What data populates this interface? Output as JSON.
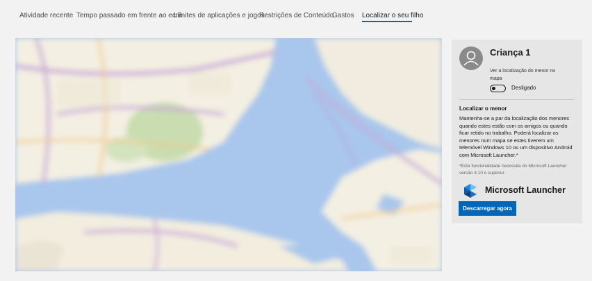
{
  "tabs": [
    {
      "label": "Atividade recente"
    },
    {
      "label": "Tempo passado em frente ao ecrã"
    },
    {
      "label": "Limites de aplicações e jogos"
    },
    {
      "label": "Restrições de Conteúdo"
    },
    {
      "label": "Gastos"
    },
    {
      "label": "Localizar o seu filho",
      "active": true
    }
  ],
  "colors": {
    "accent": "#0067b8",
    "panel_background": "#e6e6e6",
    "map_water": "#a9c6ec",
    "map_land": "#f3efe2"
  },
  "child_panel": {
    "name": "Criança 1",
    "location_description": "Ver a localização do menor no mapa",
    "toggle_state": "Desligado",
    "section_title": "Localizar o menor",
    "section_body": "Mantenha-se a par da localização dos menores quando estes estão com os amigos ou quando ficar retido no trabalho. Poderá localizar os menores num mapa se estes tiverem um telemóvel Windows 10 ou um dispositivo Android com Microsoft Launcher.*",
    "footnote": "*Esta funcionalidade necessita do Microsoft Launcher versão 4.10 e superior.",
    "launcher_name": "Microsoft Launcher",
    "download_button": "Descarregar agora",
    "avatar_icon": "person-icon",
    "launcher_icon": "microsoft-launcher-logo"
  },
  "map": {
    "description_icon": "map-image"
  }
}
